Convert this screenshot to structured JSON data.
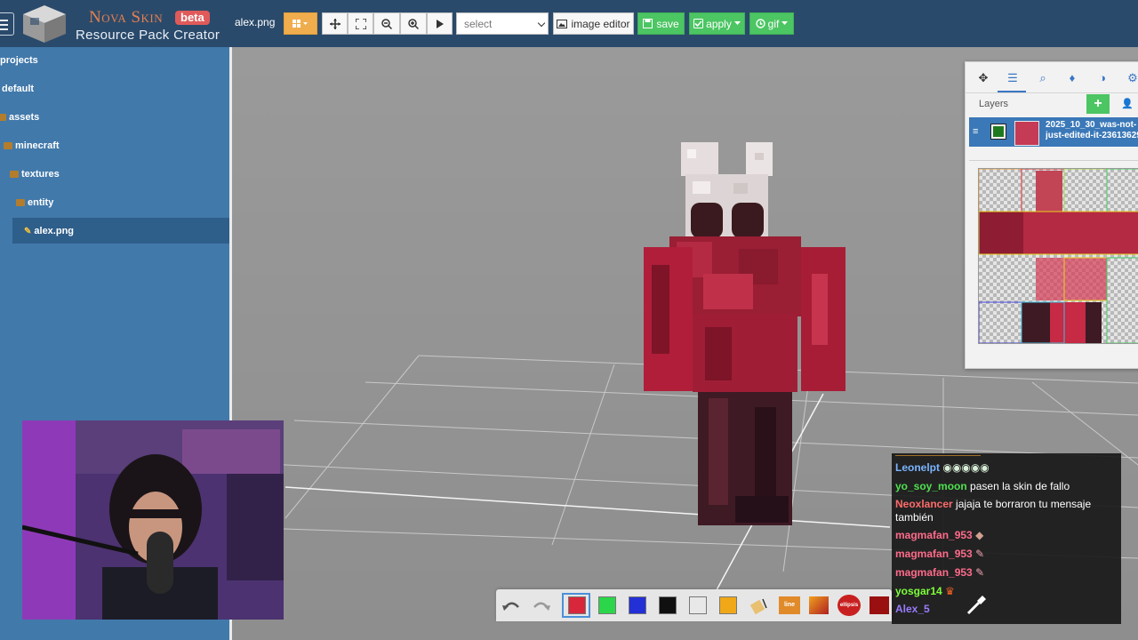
{
  "header": {
    "brand": "Nova Skin",
    "beta": "beta",
    "subtitle": "Resource Pack Creator",
    "filename": "alex.png",
    "select_value": "select",
    "image_editor": "image editor",
    "save": "save",
    "apply": "apply",
    "gif": "gif"
  },
  "tree": {
    "projects": "projects",
    "default": "default",
    "assets": "assets",
    "minecraft": "minecraft",
    "textures": "textures",
    "entity": "entity",
    "file": "alex.png"
  },
  "layers": {
    "title": "Layers",
    "add": "+",
    "layer_name_1": "2025_10_30_was-not-",
    "layer_name_2": "just-edited-it-23613629",
    "tab_icons": [
      "move-icon",
      "list-icon",
      "search-icon",
      "drop-icon",
      "contrast-icon",
      "gear-icon"
    ]
  },
  "chat": [
    {
      "user": "Leonelpt",
      "color": "#7ab4ff",
      "text": ""
    },
    {
      "user": "yo_soy_moon",
      "color": "#4fe04f",
      "text": "pasen la skin de fallo"
    },
    {
      "user": "Neoxlancer",
      "color": "#ff6b6b",
      "text": "jajaja te borraron tu mensaje también"
    },
    {
      "user": "magmafan_953",
      "color": "#ff6b8b",
      "text": ""
    },
    {
      "user": "magmafan_953",
      "color": "#ff6b8b",
      "text": ""
    },
    {
      "user": "magmafan_953",
      "color": "#ff6b8b",
      "text": ""
    },
    {
      "user": "yosgar14",
      "color": "#7dff3a",
      "text": ""
    },
    {
      "user": "Alex_5",
      "color": "#9a7bff",
      "text": ""
    }
  ],
  "palette": {
    "line": "line",
    "ellipsis": "ellipsis",
    "colors": [
      "#d8263a",
      "#2bd64a",
      "#2230d6",
      "#101010",
      "#e8e8e8",
      "#f0a818"
    ]
  }
}
